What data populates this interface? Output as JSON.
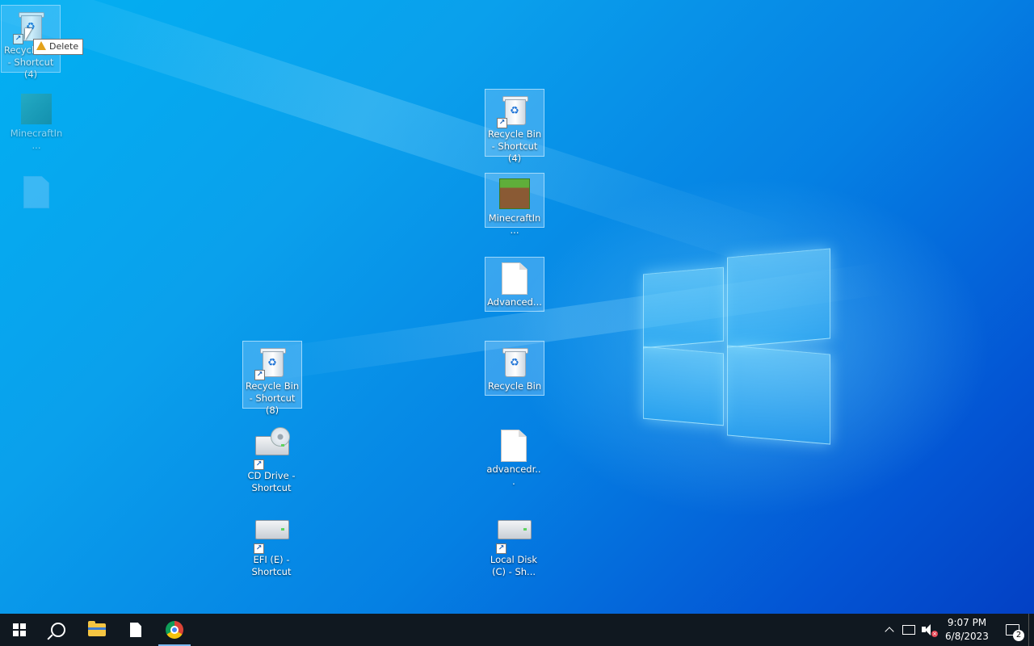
{
  "desktop": {
    "icons": [
      {
        "id": "rb4-drag",
        "label": "Recycle Bin - Shortcut (4)",
        "type": "recycle-bin-shortcut"
      },
      {
        "id": "mc-ghost",
        "label": "MinecraftIn...",
        "type": "minecraft"
      },
      {
        "id": "rb4",
        "label": "Recycle Bin - Shortcut (4)",
        "type": "recycle-bin-shortcut"
      },
      {
        "id": "mc",
        "label": "MinecraftIn...",
        "type": "minecraft"
      },
      {
        "id": "adv",
        "label": "Advanced...",
        "type": "text-file"
      },
      {
        "id": "rb8",
        "label": "Recycle Bin - Shortcut (8)",
        "type": "recycle-bin-shortcut"
      },
      {
        "id": "rb",
        "label": "Recycle Bin",
        "type": "recycle-bin"
      },
      {
        "id": "cd",
        "label": "CD Drive - Shortcut",
        "type": "cd-drive-shortcut"
      },
      {
        "id": "advdr",
        "label": "advancedr...",
        "type": "text-file"
      },
      {
        "id": "efi",
        "label": "EFI (E) - Shortcut",
        "type": "drive-shortcut"
      },
      {
        "id": "cdisk",
        "label": "Local Disk (C) - Sh...",
        "type": "drive-shortcut"
      }
    ],
    "drag_tooltip": {
      "label": "Delete",
      "icon": "warning-icon"
    }
  },
  "taskbar": {
    "buttons": [
      {
        "name": "start-button",
        "icon": "windows-icon"
      },
      {
        "name": "search-button",
        "icon": "search-icon"
      },
      {
        "name": "file-explorer-button",
        "icon": "folder-icon"
      },
      {
        "name": "notepad-button",
        "icon": "document-icon"
      },
      {
        "name": "chrome-button",
        "icon": "chrome-icon",
        "active": true
      }
    ],
    "tray": {
      "time": "9:07 PM",
      "date": "6/8/2023",
      "notification_count": "2"
    }
  },
  "colors": {
    "taskbar_bg": "#101820",
    "desktop_accent": "#0580e3"
  }
}
